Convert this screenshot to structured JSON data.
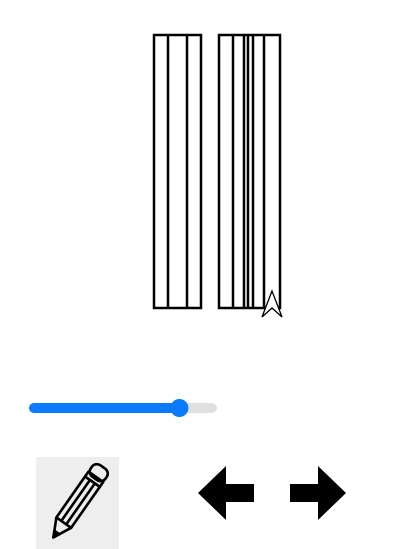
{
  "canvas": {
    "stroke_color": "#000000",
    "cursor_icon": "arrow-cursor-icon"
  },
  "slider": {
    "value_fraction": 0.8,
    "fill_color": "#0a7aff",
    "track_color": "#e0e0e0",
    "thumb_color": "#0a7aff"
  },
  "toolbar": {
    "pencil": {
      "icon": "pencil-icon",
      "active": true,
      "background": "#eeeeee"
    },
    "prev": {
      "icon": "arrow-left-icon"
    },
    "next": {
      "icon": "arrow-right-icon"
    }
  }
}
